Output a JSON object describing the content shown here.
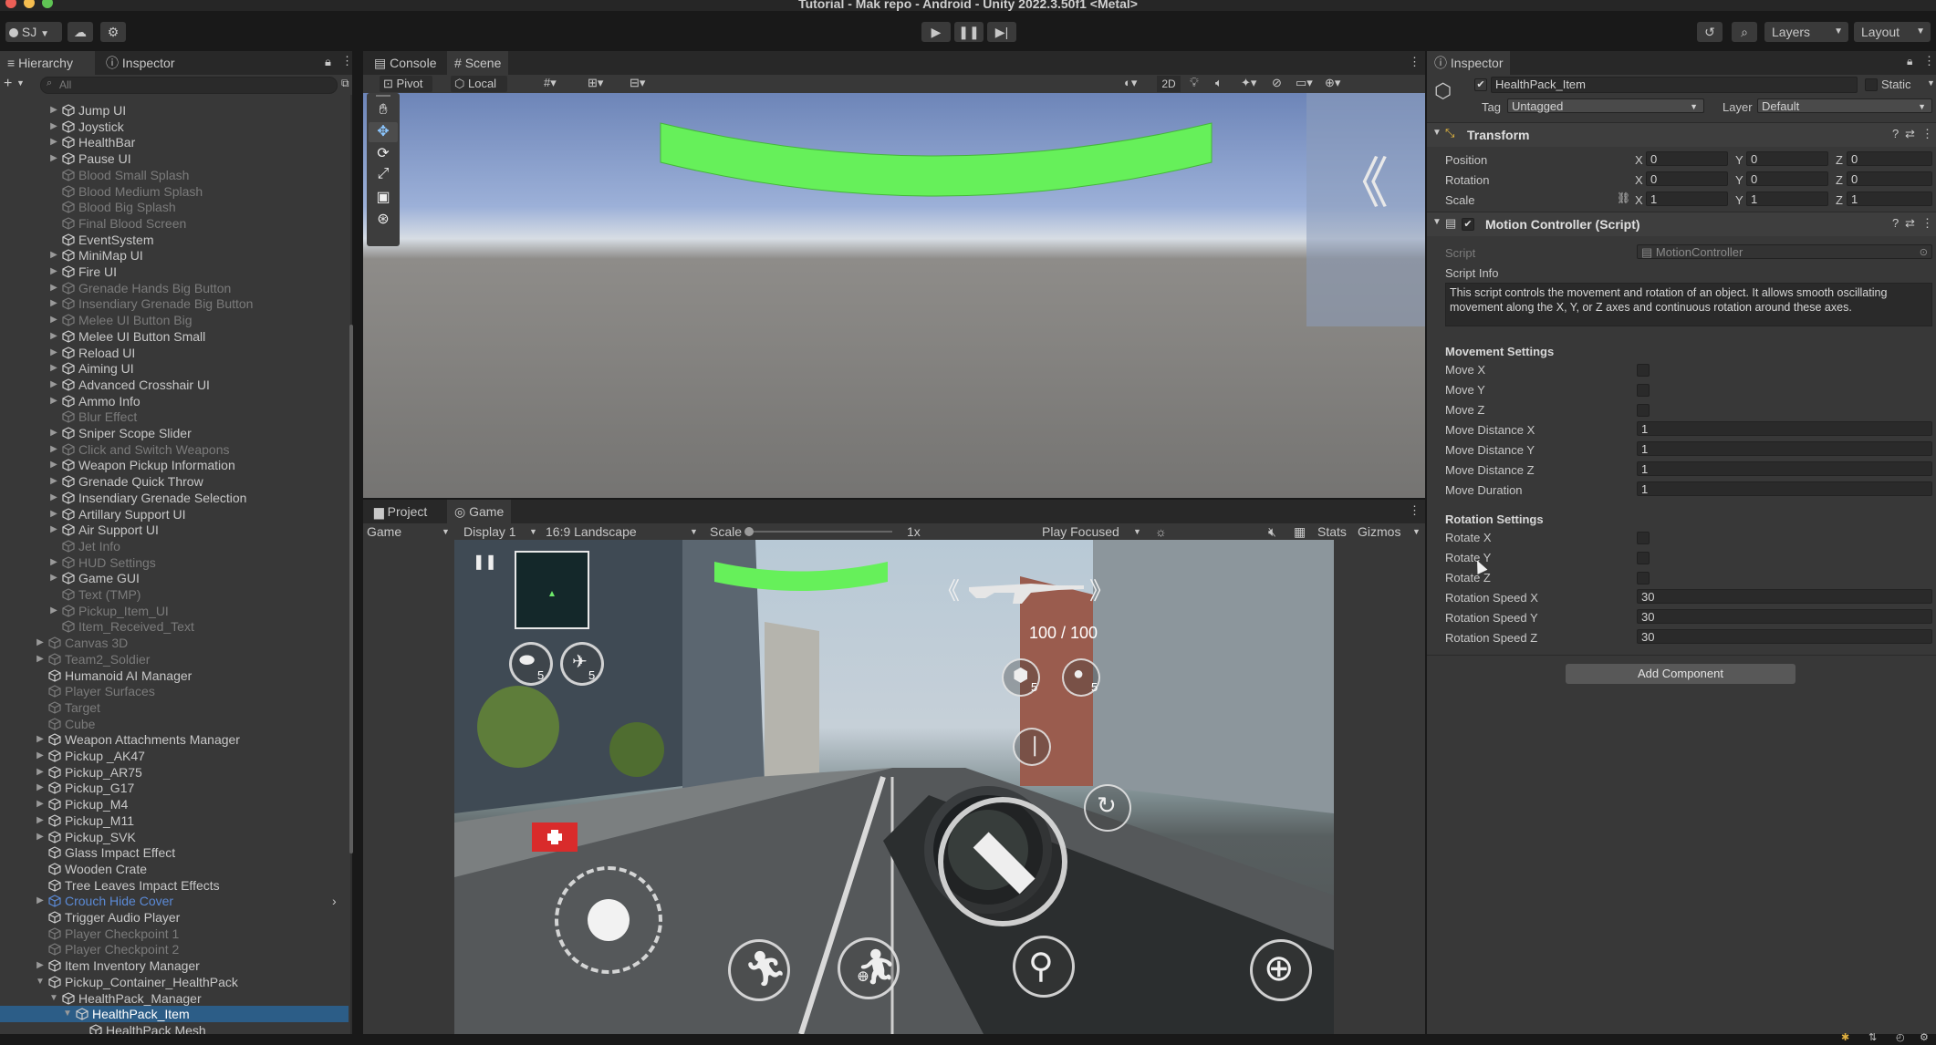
{
  "window": {
    "title": "Tutorial - Mak repo - Android - Unity 2022.3.50f1 <Metal>"
  },
  "toolbar": {
    "account": "SJ",
    "layers": "Layers",
    "layout": "Layout"
  },
  "hierarchy": {
    "tabs": [
      "Hierarchy",
      "Inspector"
    ],
    "search_placeholder": "All",
    "items": [
      {
        "label": "Jump UI",
        "indent": 2,
        "arrow": "right",
        "dim": false
      },
      {
        "label": "Joystick",
        "indent": 2,
        "arrow": "right",
        "dim": false
      },
      {
        "label": "HealthBar",
        "indent": 2,
        "arrow": "right",
        "dim": false
      },
      {
        "label": "Pause UI",
        "indent": 2,
        "arrow": "right",
        "dim": false
      },
      {
        "label": "Blood Small Splash",
        "indent": 2,
        "arrow": "none",
        "dim": true
      },
      {
        "label": "Blood Medium Splash",
        "indent": 2,
        "arrow": "none",
        "dim": true
      },
      {
        "label": "Blood Big Splash",
        "indent": 2,
        "arrow": "none",
        "dim": true
      },
      {
        "label": "Final Blood Screen",
        "indent": 2,
        "arrow": "none",
        "dim": true
      },
      {
        "label": "EventSystem",
        "indent": 2,
        "arrow": "none",
        "dim": false
      },
      {
        "label": "MiniMap UI",
        "indent": 2,
        "arrow": "right",
        "dim": false
      },
      {
        "label": "Fire UI",
        "indent": 2,
        "arrow": "right",
        "dim": false
      },
      {
        "label": "Grenade Hands Big Button",
        "indent": 2,
        "arrow": "right",
        "dim": true
      },
      {
        "label": "Insendiary Grenade Big Button",
        "indent": 2,
        "arrow": "right",
        "dim": true
      },
      {
        "label": "Melee UI Button Big",
        "indent": 2,
        "arrow": "right",
        "dim": true
      },
      {
        "label": "Melee UI Button Small",
        "indent": 2,
        "arrow": "right",
        "dim": false
      },
      {
        "label": "Reload UI",
        "indent": 2,
        "arrow": "right",
        "dim": false
      },
      {
        "label": "Aiming UI",
        "indent": 2,
        "arrow": "right",
        "dim": false
      },
      {
        "label": "Advanced Crosshair UI",
        "indent": 2,
        "arrow": "right",
        "dim": false
      },
      {
        "label": "Ammo Info",
        "indent": 2,
        "arrow": "right",
        "dim": false
      },
      {
        "label": "Blur Effect",
        "indent": 2,
        "arrow": "none",
        "dim": true
      },
      {
        "label": "Sniper Scope Slider",
        "indent": 2,
        "arrow": "right",
        "dim": false
      },
      {
        "label": "Click and Switch Weapons",
        "indent": 2,
        "arrow": "right",
        "dim": true
      },
      {
        "label": "Weapon Pickup Information",
        "indent": 2,
        "arrow": "right",
        "dim": false
      },
      {
        "label": "Grenade Quick Throw",
        "indent": 2,
        "arrow": "right",
        "dim": false
      },
      {
        "label": "Insendiary Grenade Selection",
        "indent": 2,
        "arrow": "right",
        "dim": false
      },
      {
        "label": "Artillary Support UI",
        "indent": 2,
        "arrow": "right",
        "dim": false
      },
      {
        "label": "Air Support UI",
        "indent": 2,
        "arrow": "right",
        "dim": false
      },
      {
        "label": "Jet Info",
        "indent": 2,
        "arrow": "none",
        "dim": true
      },
      {
        "label": "HUD Settings",
        "indent": 2,
        "arrow": "right",
        "dim": true
      },
      {
        "label": "Game GUI",
        "indent": 2,
        "arrow": "right",
        "dim": false
      },
      {
        "label": "Text (TMP)",
        "indent": 2,
        "arrow": "none",
        "dim": true
      },
      {
        "label": "Pickup_Item_UI",
        "indent": 2,
        "arrow": "right",
        "dim": true
      },
      {
        "label": "Item_Received_Text",
        "indent": 2,
        "arrow": "none",
        "dim": true
      },
      {
        "label": "Canvas 3D",
        "indent": 1,
        "arrow": "right",
        "dim": true
      },
      {
        "label": "Team2_Soldier",
        "indent": 1,
        "arrow": "right",
        "dim": true
      },
      {
        "label": "Humanoid AI Manager",
        "indent": 1,
        "arrow": "none",
        "dim": false
      },
      {
        "label": "Player Surfaces",
        "indent": 1,
        "arrow": "none",
        "dim": true
      },
      {
        "label": "Target",
        "indent": 1,
        "arrow": "none",
        "dim": true
      },
      {
        "label": "Cube",
        "indent": 1,
        "arrow": "none",
        "dim": true
      },
      {
        "label": "Weapon Attachments Manager",
        "indent": 1,
        "arrow": "right",
        "dim": false
      },
      {
        "label": "Pickup _AK47",
        "indent": 1,
        "arrow": "right",
        "dim": false
      },
      {
        "label": "Pickup_AR75",
        "indent": 1,
        "arrow": "right",
        "dim": false
      },
      {
        "label": "Pickup_G17",
        "indent": 1,
        "arrow": "right",
        "dim": false
      },
      {
        "label": "Pickup_M4",
        "indent": 1,
        "arrow": "right",
        "dim": false
      },
      {
        "label": "Pickup_M11",
        "indent": 1,
        "arrow": "right",
        "dim": false
      },
      {
        "label": "Pickup_SVK",
        "indent": 1,
        "arrow": "right",
        "dim": false
      },
      {
        "label": "Glass Impact Effect",
        "indent": 1,
        "arrow": "none",
        "dim": false
      },
      {
        "label": "Wooden Crate",
        "indent": 1,
        "arrow": "none",
        "dim": false
      },
      {
        "label": "Tree Leaves Impact Effects",
        "indent": 1,
        "arrow": "none",
        "dim": false
      },
      {
        "label": "Crouch Hide Cover",
        "indent": 1,
        "arrow": "right",
        "dim": false,
        "blue": true
      },
      {
        "label": "Trigger Audio Player",
        "indent": 1,
        "arrow": "none",
        "dim": false
      },
      {
        "label": "Player Checkpoint 1",
        "indent": 1,
        "arrow": "none",
        "dim": true
      },
      {
        "label": "Player Checkpoint 2",
        "indent": 1,
        "arrow": "none",
        "dim": true
      },
      {
        "label": "Item Inventory Manager",
        "indent": 1,
        "arrow": "right",
        "dim": false
      },
      {
        "label": "Pickup_Container_HealthPack",
        "indent": 1,
        "arrow": "down",
        "dim": false
      },
      {
        "label": "HealthPack_Manager",
        "indent": 2,
        "arrow": "down",
        "dim": false
      },
      {
        "label": "HealthPack_Item",
        "indent": 3,
        "arrow": "down",
        "dim": false,
        "selected": true
      },
      {
        "label": "HealthPack Mesh",
        "indent": 4,
        "arrow": "none",
        "dim": false
      }
    ]
  },
  "scene": {
    "tabs": [
      "Console",
      "Scene"
    ],
    "pivot": "Pivot",
    "local": "Local",
    "mode_2d": "2D"
  },
  "game": {
    "tabs": [
      "Project",
      "Game"
    ],
    "game_select": "Game",
    "display": "Display 1",
    "aspect": "16:9 Landscape",
    "scale_label": "Scale",
    "scale_value": "1x",
    "play_mode": "Play Focused",
    "stats": "Stats",
    "gizmos": "Gizmos",
    "hud": {
      "ammo": "100 / 100",
      "grenade_count_1": "5",
      "grenade_count_2": "5",
      "grenade_count_3": "5",
      "grenade_count_4": "5"
    }
  },
  "inspector": {
    "tab": "Inspector",
    "object_name": "HealthPack_Item",
    "static_label": "Static",
    "tag_label": "Tag",
    "tag_value": "Untagged",
    "layer_label": "Layer",
    "layer_value": "Default",
    "transform": {
      "title": "Transform",
      "position_label": "Position",
      "rotation_label": "Rotation",
      "scale_label": "Scale",
      "position": [
        "0",
        "0",
        "0"
      ],
      "rotation": [
        "0",
        "0",
        "0"
      ],
      "scale": [
        "1",
        "1",
        "1"
      ],
      "axes": [
        "X",
        "Y",
        "Z"
      ]
    },
    "motion": {
      "title": "Motion Controller (Script)",
      "script_label": "Script",
      "script_value": "MotionController",
      "info_label": "Script Info",
      "info_text": "This script controls the movement and rotation of an object. It allows smooth oscillating movement along the X, Y, or Z axes and continuous rotation around these axes.",
      "movement_header": "Movement Settings",
      "move_x": "Move X",
      "move_y": "Move Y",
      "move_z": "Move Z",
      "move_distance_x_label": "Move Distance X",
      "move_distance_x": "1",
      "move_distance_y_label": "Move Distance Y",
      "move_distance_y": "1",
      "move_distance_z_label": "Move Distance Z",
      "move_distance_z": "1",
      "move_duration_label": "Move Duration",
      "move_duration": "1",
      "rotation_header": "Rotation Settings",
      "rotate_x": "Rotate X",
      "rotate_y": "Rotate Y",
      "rotate_z": "Rotate Z",
      "rotation_speed_x_label": "Rotation Speed X",
      "rotation_speed_x": "30",
      "rotation_speed_y_label": "Rotation Speed Y",
      "rotation_speed_y": "30",
      "rotation_speed_z_label": "Rotation Speed Z",
      "rotation_speed_z": "30"
    },
    "add_component": "Add Component"
  },
  "colors": {
    "accent_selection": "#2c5d87",
    "health_bar": "#66f05a",
    "prefab_blue": "#5b8ad6"
  }
}
